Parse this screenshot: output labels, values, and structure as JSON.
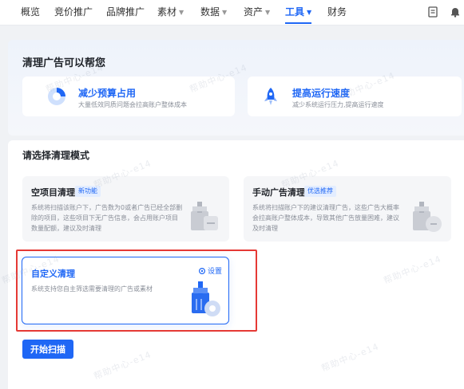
{
  "nav": {
    "items": [
      {
        "label": "概览",
        "dropdown": false
      },
      {
        "label": "竞价推广",
        "dropdown": false
      },
      {
        "label": "品牌推广",
        "dropdown": false
      },
      {
        "label": "素材",
        "dropdown": true
      },
      {
        "label": "数据",
        "dropdown": true
      },
      {
        "label": "资产",
        "dropdown": true
      },
      {
        "label": "工具",
        "dropdown": true,
        "active": true
      },
      {
        "label": "财务",
        "dropdown": false
      }
    ],
    "right_icons": [
      "document-icon",
      "bell-icon"
    ]
  },
  "help": {
    "title": "清理广告可以帮您",
    "cards": [
      {
        "title": "减少预算占用",
        "desc": "大量低效同质问题会拉高账户整体成本",
        "icon": "pie-chart-icon"
      },
      {
        "title": "提高运行速度",
        "desc": "减少系统运行压力,提高运行速度",
        "icon": "rocket-icon"
      }
    ]
  },
  "modes": {
    "section_title": "请选择清理模式",
    "cards": [
      {
        "title": "空项目清理",
        "tag": "新功能",
        "desc": "系统将扫描该账户下，广告数为0或者广告已经全部删除的项目，这些项目下无广告信息，会占用账户项目数量配额，建议及时清理"
      },
      {
        "title": "手动广告清理",
        "tag": "优选推荐",
        "desc": "系统将扫描账户下的建议清理广告，这些广告大概率会拉高账户整体成本，导致其他广告放量困难，建议及时清理"
      },
      {
        "title": "自定义清理",
        "settings": "设置",
        "desc": "系统支持您自主筛选需要清理的广告或素材",
        "selected": true
      }
    ]
  },
  "actions": {
    "start_scan": "开始扫描"
  },
  "watermark": "帮助中心-e14",
  "colors": {
    "accent": "#1f67f5",
    "highlight": "#e53935"
  }
}
